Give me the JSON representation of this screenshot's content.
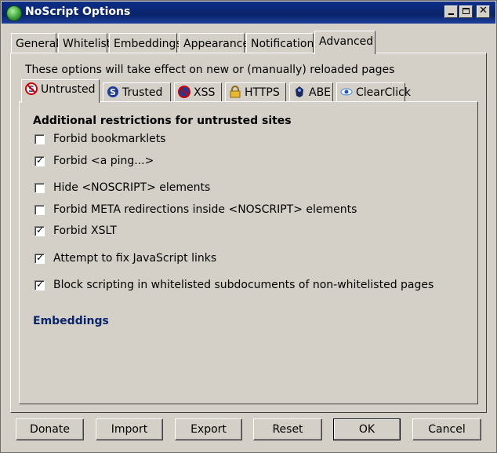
{
  "window": {
    "title": "NoScript Options"
  },
  "tabs": [
    "General",
    "Whitelist",
    "Embeddings",
    "Appearance",
    "Notifications",
    "Advanced"
  ],
  "active_tab": "Advanced",
  "notice": "These options will take effect on new or (manually) reloaded pages",
  "subtabs": [
    "Untrusted",
    "Trusted",
    "XSS",
    "HTTPS",
    "ABE",
    "ClearClick"
  ],
  "active_subtab": "Untrusted",
  "heading": "Additional restrictions for untrusted sites",
  "options": [
    {
      "label": "Forbid bookmarklets",
      "checked": false
    },
    {
      "label": "Forbid <a ping...>",
      "checked": true
    },
    {
      "label": "Hide <NOSCRIPT> elements",
      "checked": false
    },
    {
      "label": "Forbid META redirections inside <NOSCRIPT> elements",
      "checked": false
    },
    {
      "label": "Forbid XSLT",
      "checked": true
    },
    {
      "label": "Attempt to fix JavaScript links",
      "checked": true
    },
    {
      "label": "Block scripting in whitelisted subdocuments of non-whitelisted pages",
      "checked": true
    }
  ],
  "section_link": "Embeddings",
  "buttons": {
    "donate": "Donate",
    "import": "Import",
    "export": "Export",
    "reset": "Reset",
    "ok": "OK",
    "cancel": "Cancel"
  },
  "colors": {
    "title_bar": "#0a246a",
    "face": "#d4d0c8",
    "link": "#0a246a"
  }
}
